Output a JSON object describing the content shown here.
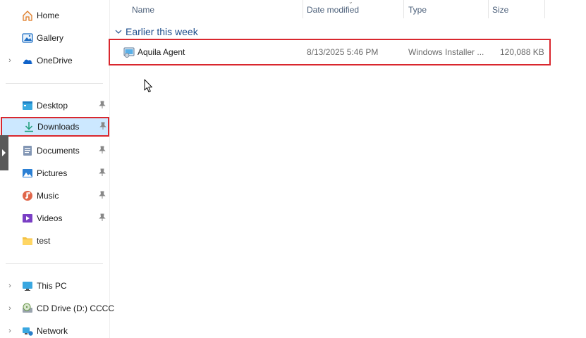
{
  "sidebar": {
    "home": "Home",
    "gallery": "Gallery",
    "onedrive": "OneDrive",
    "desktop": "Desktop",
    "downloads": "Downloads",
    "documents": "Documents",
    "pictures": "Pictures",
    "music": "Music",
    "videos": "Videos",
    "test": "test",
    "this_pc": "This PC",
    "cd_drive": "CD Drive (D:) CCCC",
    "network": "Network"
  },
  "columns": {
    "name": "Name",
    "date_modified": "Date modified",
    "type": "Type",
    "size": "Size"
  },
  "group": {
    "label": "Earlier this week"
  },
  "files": [
    {
      "name": "Aquila Agent",
      "date_modified": "8/13/2025 5:46 PM",
      "type": "Windows Installer ...",
      "size": "120,088 KB"
    }
  ],
  "colors": {
    "selection_bg": "#cce8ff",
    "highlight_border": "#d9272e",
    "group_label": "#1e4e8c",
    "header_text": "#4c607a"
  }
}
